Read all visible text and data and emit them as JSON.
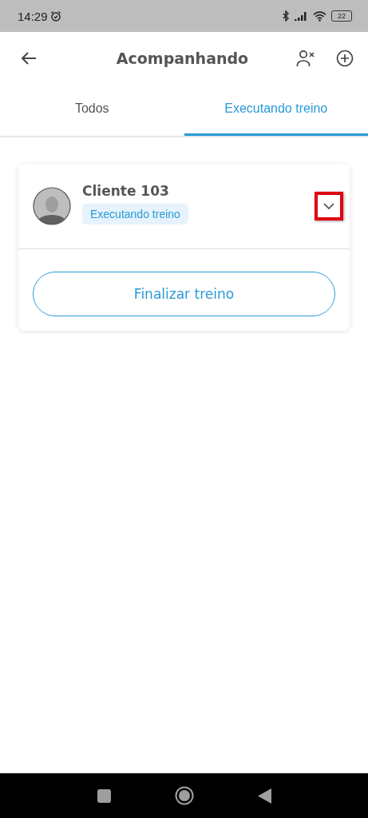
{
  "status_bar": {
    "time": "14:29",
    "battery": "22"
  },
  "app_bar": {
    "title": "Acompanhando"
  },
  "tabs": [
    {
      "label": "Todos",
      "selected": false
    },
    {
      "label": "Executando treino",
      "selected": true
    }
  ],
  "clients": [
    {
      "name": "Cliente 103",
      "status": "Executando treino",
      "expanded": false,
      "highlighted": true,
      "action": "Finalizar treino"
    }
  ]
}
